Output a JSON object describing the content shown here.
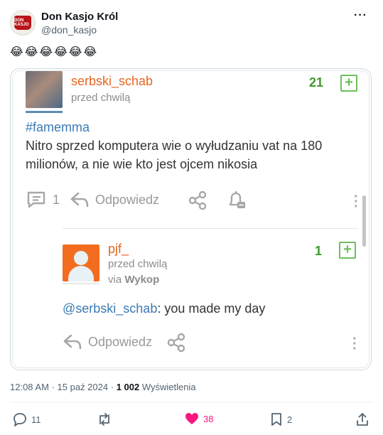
{
  "author": {
    "name": "Don Kasjo Król",
    "handle": "@don_kasjo",
    "avatar_text": "DON KASJO"
  },
  "tweet_text": "😂😂😂😂😂😂",
  "embed": {
    "post": {
      "username": "serbski_schab",
      "time": "przed chwilą",
      "votes": "21",
      "hashtag": "#famemma",
      "text": "Nitro sprzed komputera wie o wyłudzaniu vat na 180 milionów, a nie wie kto jest ojcem nikosia",
      "comment_count": "1",
      "reply_label": "Odpowiedz"
    },
    "reply": {
      "username": "pjf_",
      "time": "przed chwilą",
      "via_prefix": "via",
      "via_source": "Wykop",
      "votes": "1",
      "mention": "@serbski_schab",
      "text": ": you made my day",
      "reply_label": "Odpowiedz"
    }
  },
  "meta": {
    "time": "12:08 AM",
    "sep": "·",
    "date": "15 paź 2024",
    "views_count": "1 002",
    "views_label": "Wyświetlenia"
  },
  "actions": {
    "replies": "11",
    "likes": "38",
    "bookmarks": "2"
  },
  "colors": {
    "wykop_orange": "#e8651f",
    "wykop_green": "#3f9a2a",
    "like_pink": "#f91880"
  }
}
